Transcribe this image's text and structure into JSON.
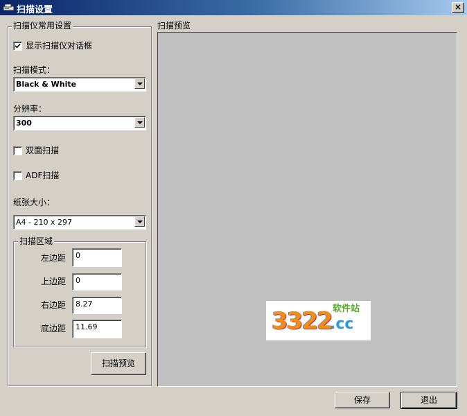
{
  "window": {
    "title": "扫描设置",
    "close_glyph": "×"
  },
  "left_group": {
    "legend": "扫描仪常用设置"
  },
  "show_dialog": {
    "label": "显示扫描仪对话框",
    "checked": true
  },
  "scan_mode": {
    "label": "扫描模式：",
    "value": "Black & White"
  },
  "resolution": {
    "label": "分辨率：",
    "value": "300"
  },
  "duplex": {
    "label": "双面扫描",
    "checked": false
  },
  "adf": {
    "label": "ADF扫描",
    "checked": false
  },
  "paper_size": {
    "label": "纸张大小：",
    "value": "A4 - 210 x 297"
  },
  "scan_area": {
    "legend": "扫描区域",
    "left_label": "左边距",
    "left_value": "0",
    "top_label": "上边距",
    "top_value": "0",
    "right_label": "右边距",
    "right_value": "8.27",
    "bottom_label": "底边距",
    "bottom_value": "11.69"
  },
  "preview_button": {
    "label": "扫描预览"
  },
  "preview_group": {
    "legend": "扫描预览"
  },
  "watermark": {
    "number": "3322",
    "domain": ".cc",
    "tag": "软件站"
  },
  "buttons": {
    "save": "保存",
    "exit": "退出"
  },
  "colors": {
    "titlebar_start": "#0a246a",
    "titlebar_end": "#a6caf0",
    "dialog_bg": "#d4d0c8",
    "preview_bg": "#c0c0c0"
  }
}
